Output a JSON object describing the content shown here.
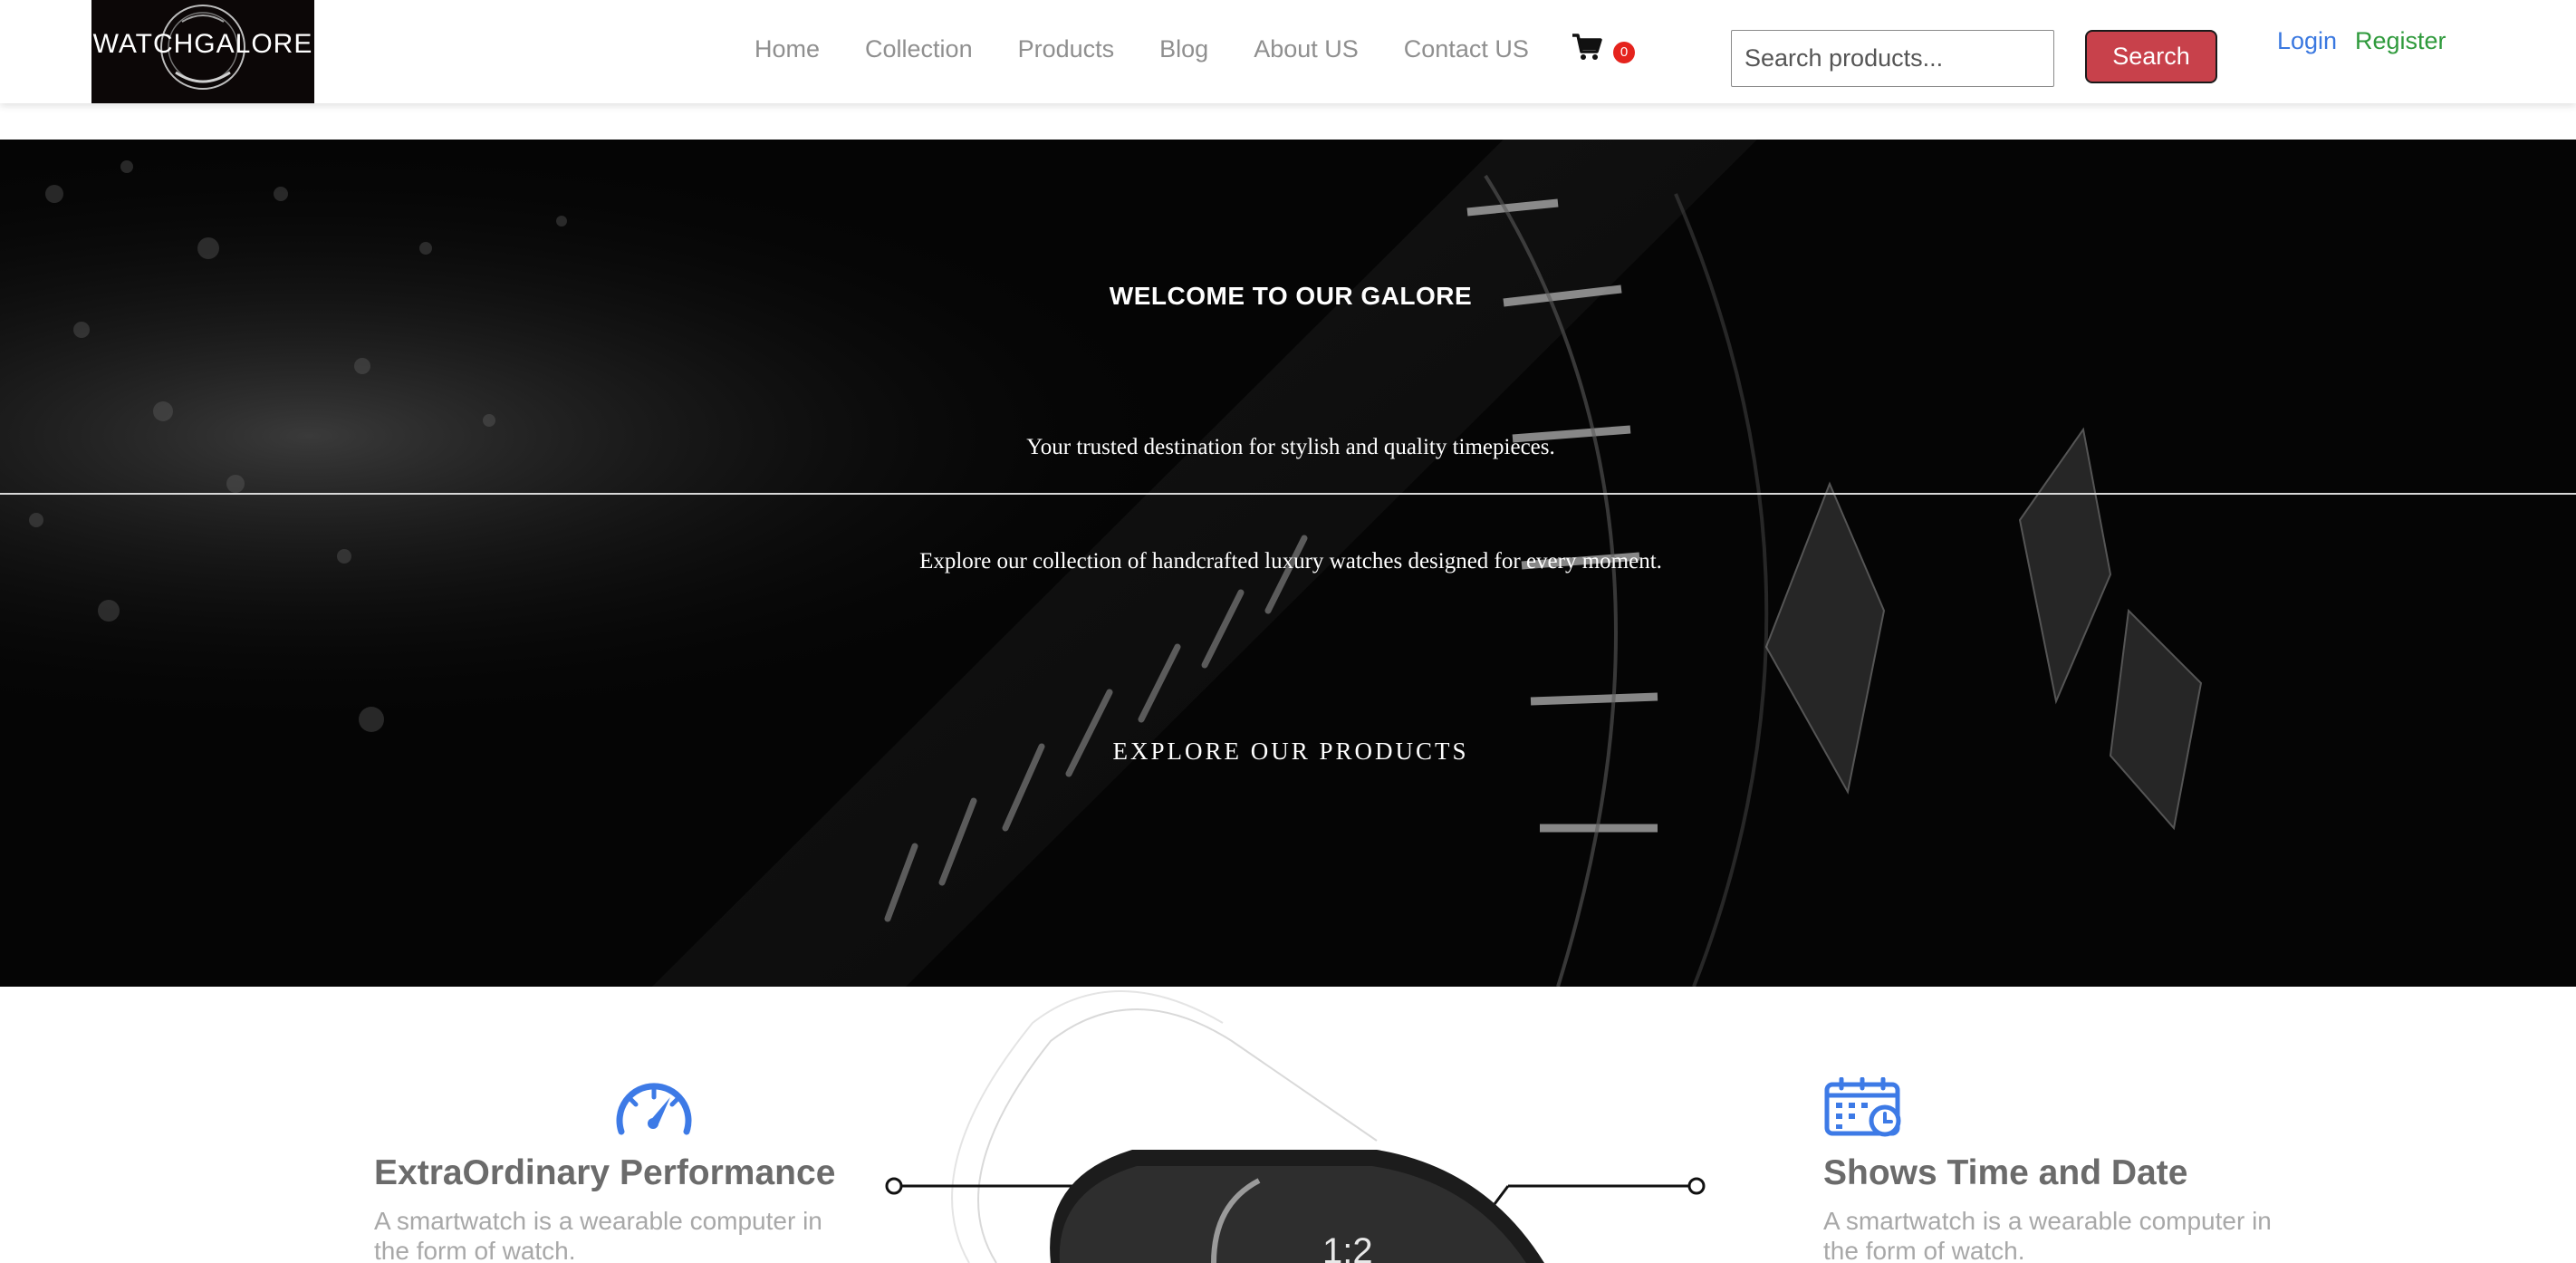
{
  "brand": {
    "logo_text": "WATCHGALORE",
    "colors": {
      "accent": "#c8414b",
      "login": "#3a78e0",
      "register": "#2f9a3c",
      "badge": "#e5231d"
    }
  },
  "nav": {
    "links": [
      "Home",
      "Collection",
      "Products",
      "Blog",
      "About US",
      "Contact US"
    ],
    "cart_icon": "shopping-cart-icon",
    "cart_count": "0"
  },
  "search": {
    "placeholder": "Search products...",
    "button_label": "Search"
  },
  "auth": {
    "login_label": "Login",
    "register_label": "Register"
  },
  "hero": {
    "title": "WELCOME TO OUR GALORE",
    "subtitle": "Your trusted destination for stylish and quality timepieces.",
    "description": "Explore our collection of handcrafted luxury watches designed for every moment.",
    "cta_label": "EXPLORE OUR PRODUCTS"
  },
  "features": {
    "left": {
      "icon": "speedometer-icon",
      "title": "ExtraOrdinary Performance",
      "description": "A smartwatch is a wearable computer in the form of watch."
    },
    "right": {
      "icon": "calendar-clock-icon",
      "title": "Shows Time and Date",
      "description": "A smartwatch is a wearable computer in the form of watch."
    }
  }
}
